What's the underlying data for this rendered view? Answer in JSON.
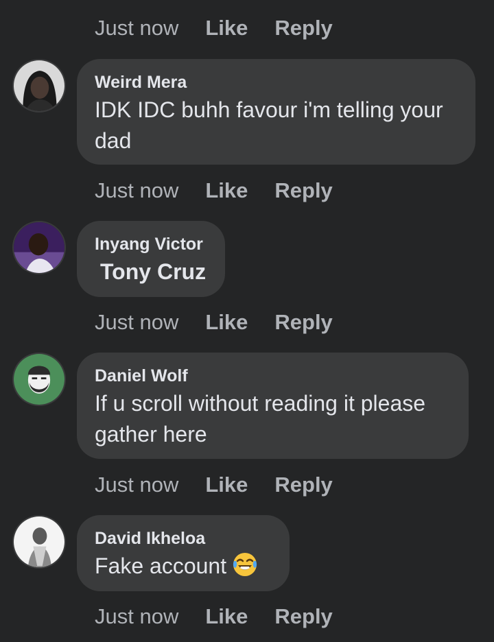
{
  "top_actions": {
    "time": "Just now",
    "like": "Like",
    "reply": "Reply"
  },
  "comments": [
    {
      "author": "Weird Mera",
      "text": "IDK IDC buhh favour i'm telling your dad",
      "avatar_icon": "user-photo-icon",
      "actions": {
        "time": "Just now",
        "like": "Like",
        "reply": "Reply"
      }
    },
    {
      "author": "Inyang Victor",
      "text": "Tony Cruz",
      "tag_mention": true,
      "avatar_icon": "user-photo-icon",
      "actions": {
        "time": "Just now",
        "like": "Like",
        "reply": "Reply"
      }
    },
    {
      "author": "Daniel Wolf",
      "text": "If u scroll without reading it please gather here",
      "avatar_icon": "user-photo-icon",
      "actions": {
        "time": "Just now",
        "like": "Like",
        "reply": "Reply"
      }
    },
    {
      "author": "David Ikheloa",
      "text": "Fake account",
      "emoji": "tears-of-joy-emoji-icon",
      "avatar_icon": "user-photo-icon",
      "actions": {
        "time": "Just now",
        "like": "Like",
        "reply": "Reply"
      }
    }
  ],
  "colors": {
    "background": "#242526",
    "bubble": "#3a3b3c",
    "primary_text": "#e4e6eb",
    "secondary_text": "#b0b3b8"
  }
}
